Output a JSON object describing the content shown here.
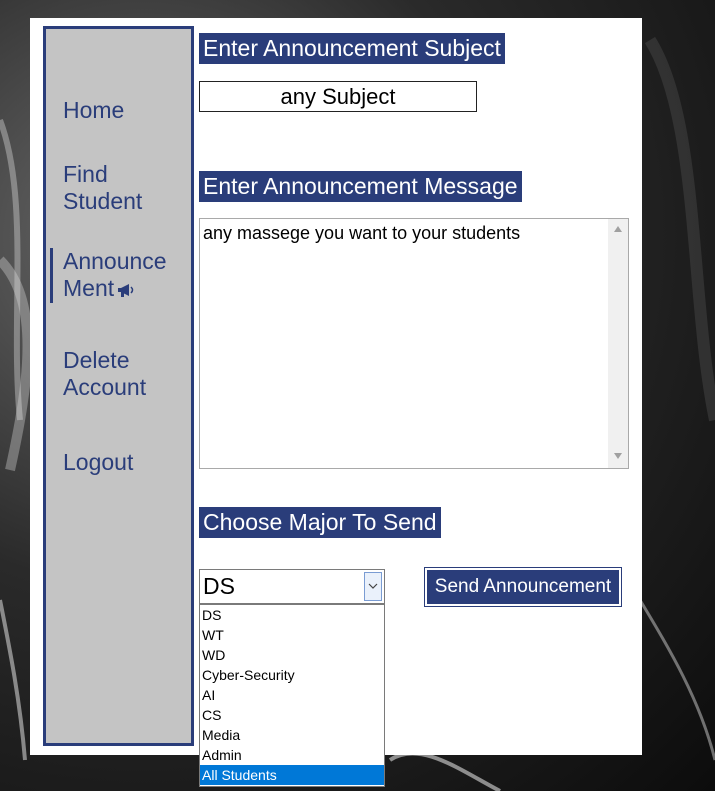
{
  "sidebar": {
    "items": [
      {
        "label_line1": "Home",
        "label_line2": ""
      },
      {
        "label_line1": "Find",
        "label_line2": "Student"
      },
      {
        "label_line1": "Announce",
        "label_line2": "Ment"
      },
      {
        "label_line1": "Delete",
        "label_line2": "Account"
      },
      {
        "label_line1": "Logout",
        "label_line2": ""
      }
    ],
    "active_item": "Announce Ment"
  },
  "form": {
    "subject_heading": "Enter Announcement Subject",
    "subject_value": "any Subject",
    "message_heading": "Enter Announcement Message",
    "message_value": "any massege you want to your students",
    "major_heading": "Choose Major To Send",
    "major_selected": "DS",
    "major_options": [
      "DS",
      "WT",
      "WD",
      "Cyber-Security",
      "AI",
      "CS",
      "Media",
      "Admin",
      "All Students"
    ],
    "major_highlighted": "All Students",
    "send_label": "Send Announcement"
  },
  "colors": {
    "accent": "#2a3d7a",
    "sidebar_bg": "#c4c4c4",
    "dropdown_highlight": "#0078d7"
  }
}
